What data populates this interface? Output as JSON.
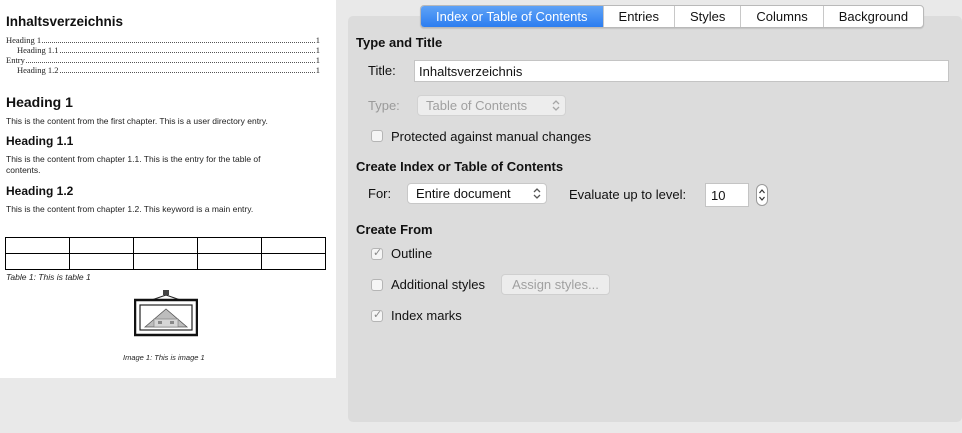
{
  "preview": {
    "title": "Inhaltsverzeichnis",
    "toc_entries": [
      {
        "label": "Heading 1",
        "page": "1"
      },
      {
        "label": "Heading 1.1",
        "page": "1"
      },
      {
        "label": "Entry",
        "page": "1"
      },
      {
        "label": "Heading 1.2",
        "page": "1"
      }
    ],
    "heading1": "Heading 1",
    "body1": "This is the content from the first chapter. This is a user directory entry.",
    "heading11": "Heading 1.1",
    "body11": "This is the content from chapter 1.1. This is the entry for the table of contents.",
    "heading12": "Heading 1.2",
    "body12": "This is the content from chapter 1.2. This keyword is a main entry.",
    "table_caption": "Table 1: This is table 1",
    "image_caption": "Image 1: This is image 1"
  },
  "tabs": [
    {
      "label": "Index or Table of Contents",
      "active": true
    },
    {
      "label": "Entries",
      "active": false
    },
    {
      "label": "Styles",
      "active": false
    },
    {
      "label": "Columns",
      "active": false
    },
    {
      "label": "Background",
      "active": false
    }
  ],
  "type_title": {
    "section_label": "Type and Title",
    "title_label": "Title:",
    "title_value": "Inhaltsverzeichnis",
    "type_label": "Type:",
    "type_value": "Table of Contents",
    "protected_label": "Protected against manual changes",
    "protected_checked": false
  },
  "create_index": {
    "section_label": "Create Index or Table of Contents",
    "for_label": "For:",
    "for_value": "Entire document",
    "evaluate_label": "Evaluate up to level:",
    "level_value": "10"
  },
  "create_from": {
    "section_label": "Create From",
    "outline_label": "Outline",
    "outline_checked": true,
    "additional_styles_label": "Additional styles",
    "additional_styles_checked": false,
    "assign_styles_label": "Assign styles...",
    "index_marks_label": "Index marks",
    "index_marks_checked": true
  },
  "colors": {
    "active_tab": "#2c7df0",
    "dialog_bg": "#dcdcdc",
    "window_bg": "#e9e9e9"
  },
  "icons": {
    "select_arrows": "up-down-chevron-icon",
    "spin": "spin-arrows-icon",
    "checkmark": "checkmark-icon",
    "image": "framed-picture-icon"
  }
}
